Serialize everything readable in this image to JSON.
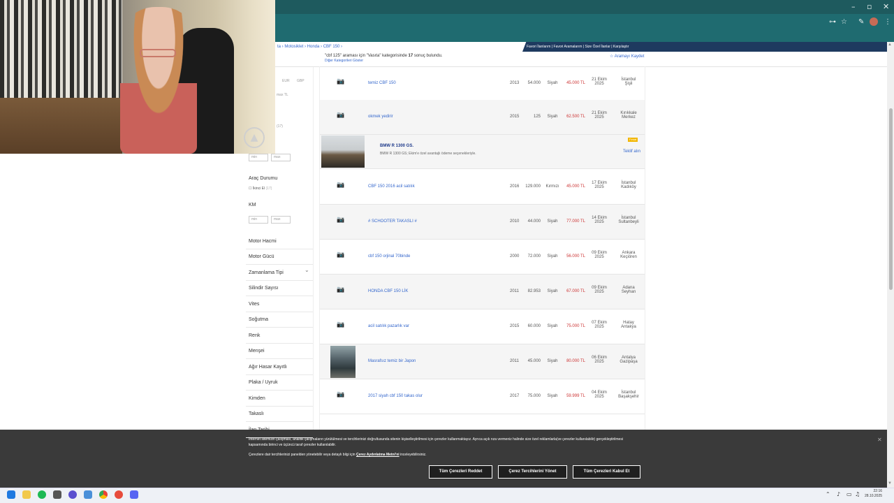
{
  "window": {
    "minimize": "–",
    "maximize": "▫",
    "close": "✕"
  },
  "toolbar": {
    "key_icon": "⊶",
    "star_icon": "☆",
    "ext_icon": "✎",
    "menu_icon": "⋮"
  },
  "header": {
    "breadcrumb": "ta  ›  Motosiklet  ›  Honda  ›  CBF 150  ›",
    "fav_links": "Favori İlanlarım  |  Favori Aramalarım  |  Size Özel İlanlar  |  Karşılaştır",
    "search_info_prefix": "\"cbf 125\" araması için \"Vasıta\" kategorisinde",
    "search_count": "17",
    "search_info_suffix": "sonuç bulundu.",
    "alt_categories": "Diğer Kategorileri Göster",
    "save_search": "☆ Aramayı Kaydet"
  },
  "sidebar": {
    "hints": {
      "eur": "EUR",
      "gbp": "GBP",
      "max_tl": "max TL",
      "count": "(17)",
      "min": "min",
      "max": "max"
    },
    "vehicle_condition": "Araç Durumu",
    "second_hand": "İkinci El",
    "second_hand_count": "(17)",
    "km": "KM",
    "items": [
      "Motor Hacmi",
      "Motor Gücü",
      "Zamanlama Tipi",
      "Silindir Sayısı",
      "Vites",
      "Soğutma",
      "Renk",
      "Menşei",
      "Ağır Hasar Kayıtlı",
      "Plaka / Uyruk",
      "Kimden",
      "Takaslı",
      "İlan Tarihi"
    ],
    "expand_icon": "⌄"
  },
  "ad": {
    "title": "BMW R 1300 GS.",
    "description": "BMW R 1300 GS; Ekim'e özel avantajlı ödeme seçenekleriyle.",
    "badge": "Fırsat",
    "offer": "Teklif alın"
  },
  "listings": [
    {
      "title": "temiz CBF 150",
      "year": "2013",
      "km": "54.000",
      "color": "Siyah",
      "price": "45.000 TL",
      "date1": "21 Ekim",
      "date2": "2025",
      "loc1": "İstanbul",
      "loc2": "Şişli",
      "photo": false
    },
    {
      "title": "okmek yedirir",
      "year": "2015",
      "km": "125",
      "color": "Siyah",
      "price": "62.500 TL",
      "date1": "21 Ekim",
      "date2": "2025",
      "loc1": "Kırıkkale",
      "loc2": "Merkez",
      "photo": false
    },
    {
      "title": "CBF 150 2016 acil satılık",
      "year": "2016",
      "km": "129.000",
      "color": "Kırmızı",
      "price": "45.000 TL",
      "date1": "17 Ekim",
      "date2": "2025",
      "loc1": "İstanbul",
      "loc2": "Kadıköy",
      "photo": false
    },
    {
      "title": "# SCHOOTER TAKASLI #",
      "year": "2010",
      "km": "44.000",
      "color": "Siyah",
      "price": "77.000 TL",
      "date1": "14 Ekim",
      "date2": "2025",
      "loc1": "İstanbul",
      "loc2": "Sultanbeyli",
      "photo": false
    },
    {
      "title": "cbf 150 orjinal 70binde",
      "year": "2000",
      "km": "72.000",
      "color": "Siyah",
      "price": "56.000 TL",
      "date1": "09 Ekim",
      "date2": "2025",
      "loc1": "Ankara",
      "loc2": "Keçiören",
      "photo": false
    },
    {
      "title": "HONDA CBF 150 LİK",
      "year": "2011",
      "km": "82.953",
      "color": "Siyah",
      "price": "67.000 TL",
      "date1": "09 Ekim",
      "date2": "2025",
      "loc1": "Adana",
      "loc2": "Seyhan",
      "photo": false
    },
    {
      "title": "acil satılık pazarlık var",
      "year": "2015",
      "km": "60.000",
      "color": "Siyah",
      "price": "75.000 TL",
      "date1": "07 Ekim",
      "date2": "2025",
      "loc1": "Hatay",
      "loc2": "Antakya",
      "photo": false
    },
    {
      "title": "Masrafsız temiz bir Japon",
      "year": "2011",
      "km": "45.000",
      "color": "Siyah",
      "price": "80.000 TL",
      "date1": "06 Ekim",
      "date2": "2025",
      "loc1": "Antalya",
      "loc2": "Gazipaşa",
      "photo": true
    },
    {
      "title": "2017 siyah cbf 150 takas olur",
      "year": "2017",
      "km": "75.000",
      "color": "Siyah",
      "price": "59.999 TL",
      "date1": "04 Ekim",
      "date2": "2025",
      "loc1": "İstanbul",
      "loc2": "Başakşehir",
      "photo": false
    }
  ],
  "cookie": {
    "text": "İnternet sitemizin çalışması, analitik çalışmaların yürütülmesi ve tercihlerinizi doğrultusunda sitenin kişiselleştirilmesi için çerezler kullanmaktayız. Ayrıca açık rıza vermeniz halinde size özel reklamlarla(ve çerezler kullanılabilir) gerçekleştirilmesi kapsamında birinci ve üçüncü taraf çerezler kullanılabilir.",
    "text2_prefix": "Çerezlere dair tercihlerinizi panelden yönetebilir veya detaylı bilgi için",
    "policy_link": "Çerez Aydınlatma Metni'ni",
    "text2_suffix": "inceleyebilirsiniz.",
    "reject": "Tüm Çerezleri Reddet",
    "manage": "Çerez Tercihlerini Yönet",
    "accept": "Tüm Çerezleri Kabul Et",
    "close_icon": "✕"
  },
  "taskbar": {
    "time": "22:16",
    "date": "28.10.2025"
  },
  "colors": {
    "accent": "#1f6b70",
    "link": "#3366cc",
    "price": "#cc3333",
    "nav_dark": "#1e3a5f"
  }
}
